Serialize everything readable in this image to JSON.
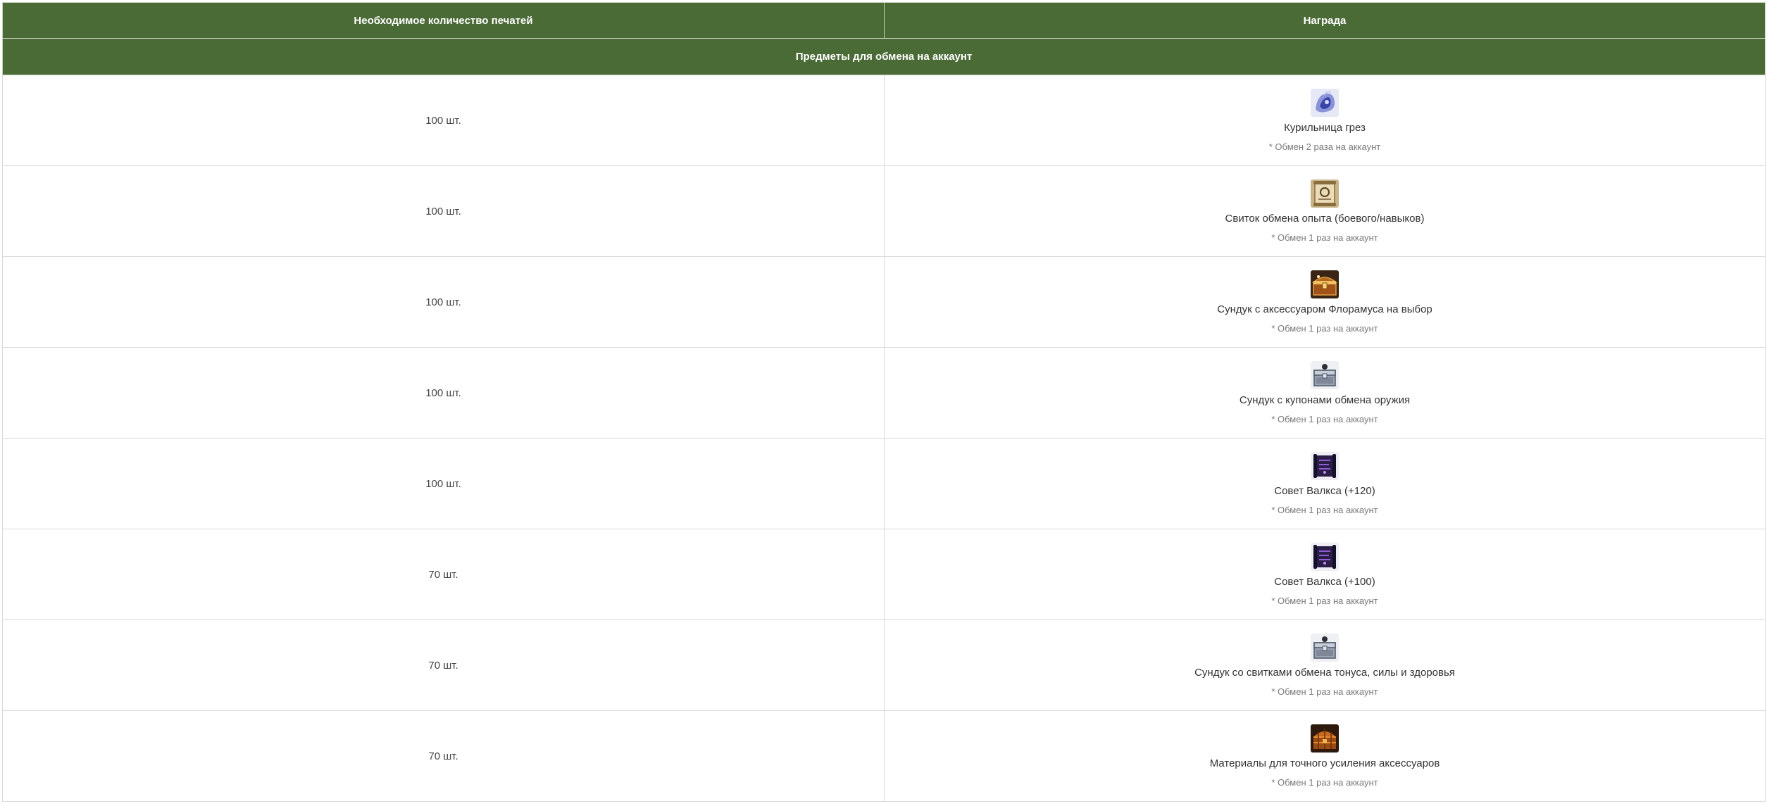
{
  "header": {
    "col_seals": "Необходимое количество печатей",
    "col_reward": "Награда"
  },
  "section": {
    "title": "Предметы для обмена на аккаунт"
  },
  "rows": [
    {
      "qty": "100 шт.",
      "icon": "incense-burner-icon",
      "name": "Курильница грез",
      "note": "* Обмен 2 раза на аккаунт"
    },
    {
      "qty": "100 шт.",
      "icon": "scroll-icon",
      "name": "Свиток обмена опыта (боевого/навыков)",
      "note": "* Обмен 1 раз на аккаунт"
    },
    {
      "qty": "100 шт.",
      "icon": "golden-chest-icon",
      "name": "Сундук с аксессуаром Флорамуса на выбор",
      "note": "* Обмен 1 раз на аккаунт"
    },
    {
      "qty": "100 шт.",
      "icon": "silver-chest-icon",
      "name": "Сундук с купонами обмена оружия",
      "note": "* Обмен 1 раз на аккаунт"
    },
    {
      "qty": "100 шт.",
      "icon": "dark-scroll-icon",
      "name": "Совет Валкса (+120)",
      "note": "* Обмен 1 раз на аккаунт"
    },
    {
      "qty": "70 шт.",
      "icon": "dark-scroll-icon",
      "name": "Совет Валкса (+100)",
      "note": "* Обмен 1 раз на аккаунт"
    },
    {
      "qty": "70 шт.",
      "icon": "silver-chest-icon",
      "name": "Сундук со свитками обмена тонуса, силы и здоровья",
      "note": "* Обмен 1 раз на аккаунт"
    },
    {
      "qty": "70 шт.",
      "icon": "wooden-chest-icon",
      "name": "Материалы для точного усиления аксессуаров",
      "note": "* Обмен 1 раз на аккаунт"
    }
  ]
}
